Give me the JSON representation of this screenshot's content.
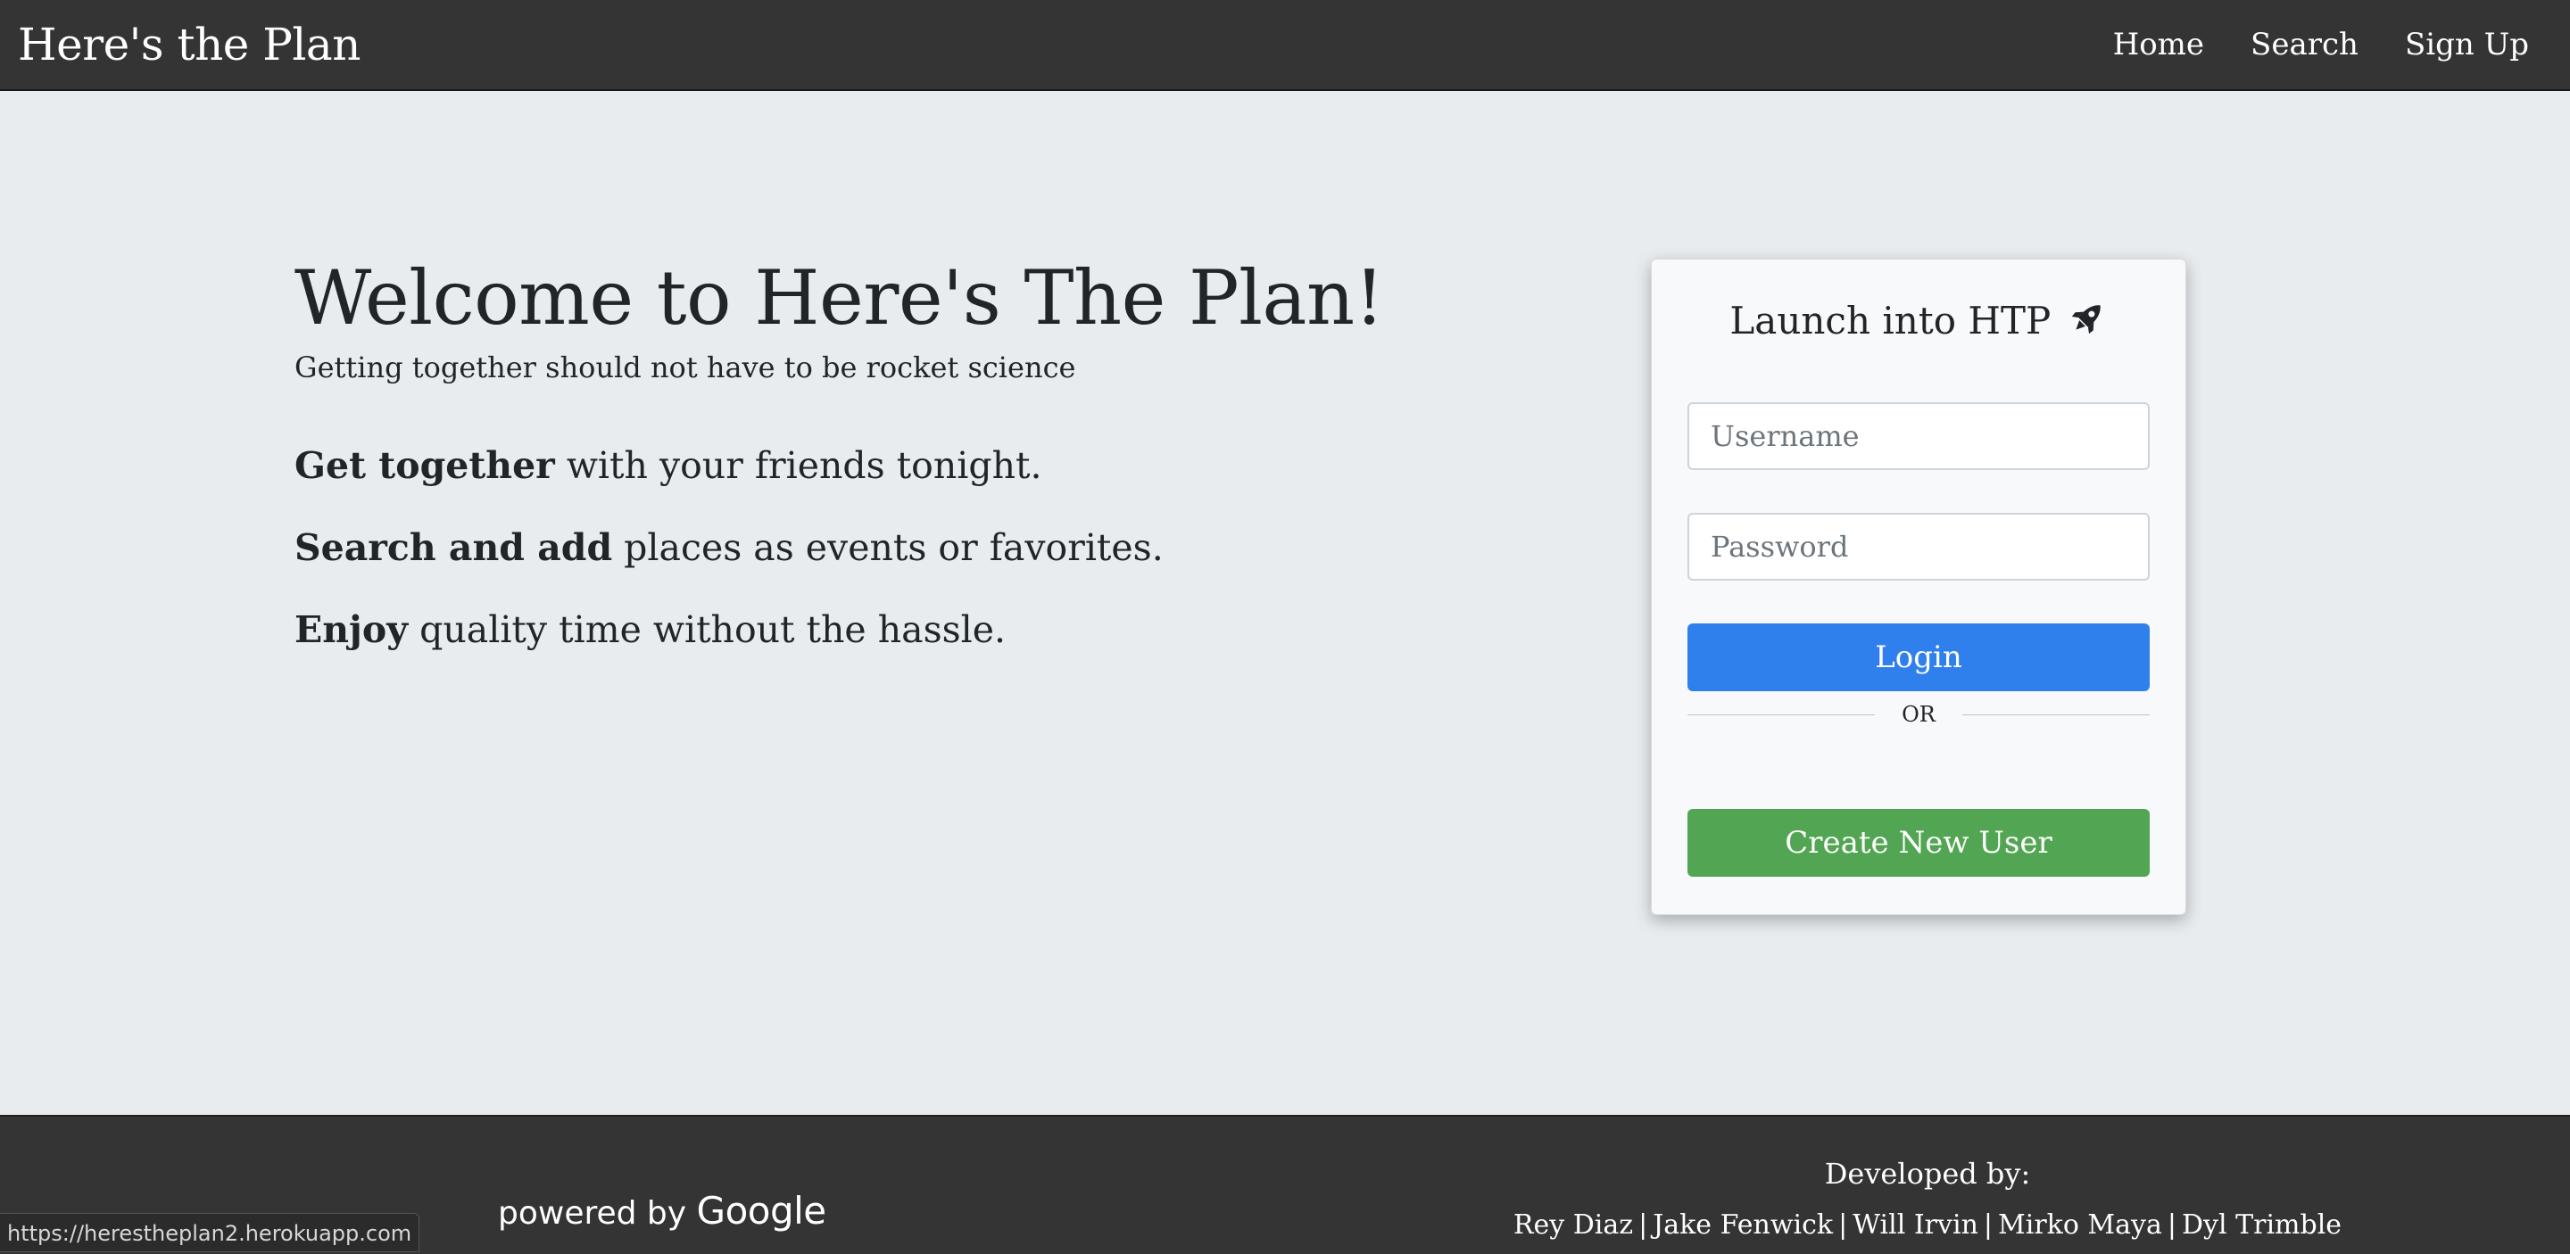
{
  "navbar": {
    "brand": "Here's the Plan",
    "links": [
      {
        "label": "Home"
      },
      {
        "label": "Search"
      },
      {
        "label": "Sign Up"
      }
    ]
  },
  "hero": {
    "title": "Welcome to Here's The Plan!",
    "subtitle": "Getting together should not have to be rocket science",
    "features": [
      {
        "bold": "Get together",
        "rest": " with your friends tonight."
      },
      {
        "bold": "Search and add",
        "rest": " places as events or favorites."
      },
      {
        "bold": "Enjoy",
        "rest": " quality time without the hassle."
      }
    ]
  },
  "login": {
    "title": "Launch into HTP",
    "title_icon": "rocket-icon",
    "username_placeholder": "Username",
    "username_value": "",
    "password_placeholder": "Password",
    "password_value": "",
    "login_label": "Login",
    "divider_text": "OR",
    "create_label": "Create New User",
    "colors": {
      "login": "#2f80ed",
      "create": "#52a552"
    }
  },
  "footer": {
    "powered_prefix": "powered by",
    "powered_brand": "Google",
    "developed_title": "Developed by:",
    "developers": [
      "Rey Diaz",
      "Jake Fenwick",
      "Will Irvin",
      "Mirko Maya",
      "Dyl Trimble"
    ],
    "separator": "|"
  },
  "status_bar": {
    "url": "https://herestheplan2.herokuapp.com"
  },
  "colors": {
    "navbar_bg": "#343434",
    "page_bg": "#e8ecef",
    "card_bg": "#f8f9fa"
  }
}
